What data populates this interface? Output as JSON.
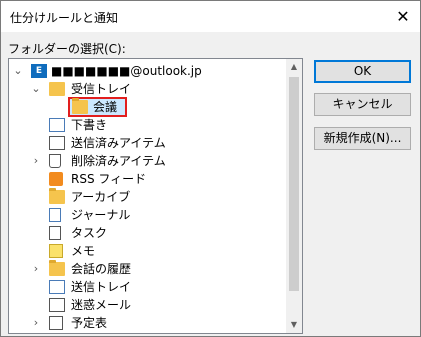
{
  "title": "仕分けルールと通知",
  "close_glyph": "✕",
  "folder_label": "フォルダーの選択(C):",
  "tree": {
    "account": "■■■■■■■@outlook.jp",
    "items": [
      {
        "label": "受信トレイ"
      },
      {
        "label": "会議"
      },
      {
        "label": "下書き"
      },
      {
        "label": "送信済みアイテム"
      },
      {
        "label": "削除済みアイテム"
      },
      {
        "label": "RSS フィード"
      },
      {
        "label": "アーカイブ"
      },
      {
        "label": "ジャーナル"
      },
      {
        "label": "タスク"
      },
      {
        "label": "メモ"
      },
      {
        "label": "会話の履歴"
      },
      {
        "label": "送信トレイ"
      },
      {
        "label": "迷惑メール"
      },
      {
        "label": "予定表"
      }
    ]
  },
  "buttons": {
    "ok": "OK",
    "cancel": "キャンセル",
    "new": "新規作成(N)..."
  },
  "colors": {
    "accent": "#0078d7",
    "selection_border": "#e21e1e",
    "folder": "#f5c44d"
  }
}
